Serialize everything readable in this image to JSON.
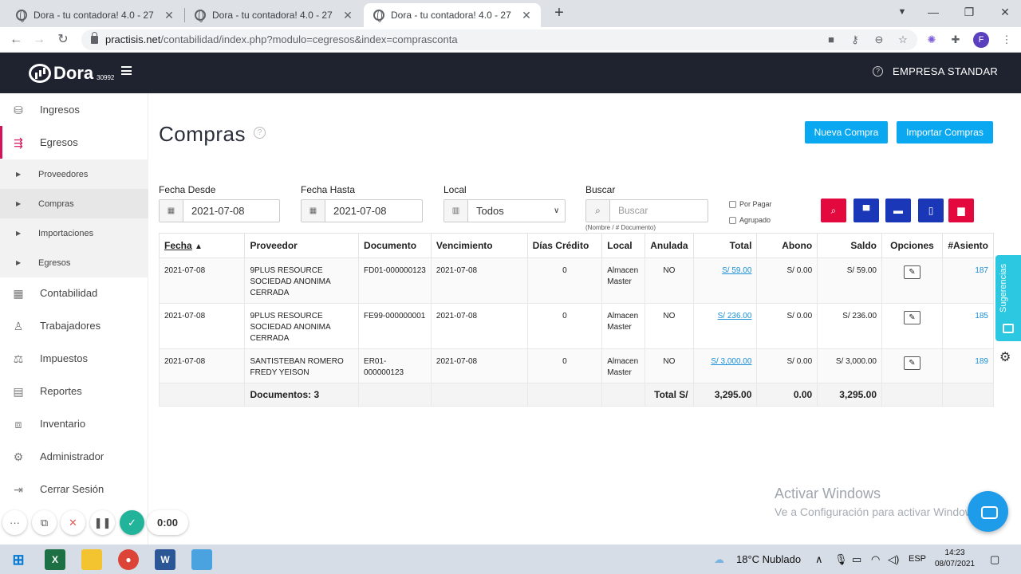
{
  "browser": {
    "tabs": [
      {
        "title": "Dora - tu contadora! 4.0 - 27",
        "active": false
      },
      {
        "title": "Dora - tu contadora! 4.0 - 27",
        "active": false
      },
      {
        "title": "Dora - tu contadora! 4.0 - 27",
        "active": true
      }
    ],
    "url_host": "practisis.net",
    "url_path": "/contabilidad/index.php?modulo=cegresos&index=comprasconta",
    "profile_initial": "F"
  },
  "header": {
    "brand": "Dora",
    "brand_code": "30992",
    "company": "EMPRESA STANDAR"
  },
  "sidebar": {
    "items": [
      {
        "label": "Ingresos",
        "icon": "coins-icon"
      },
      {
        "label": "Egresos",
        "icon": "cash-out-icon",
        "active": true
      },
      {
        "label": "Contabilidad",
        "icon": "calculator-icon"
      },
      {
        "label": "Trabajadores",
        "icon": "workers-icon"
      },
      {
        "label": "Impuestos",
        "icon": "taxes-icon"
      },
      {
        "label": "Reportes",
        "icon": "report-icon"
      },
      {
        "label": "Inventario",
        "icon": "boxes-icon"
      },
      {
        "label": "Administrador",
        "icon": "gear-icon"
      },
      {
        "label": "Cerrar Sesión",
        "icon": "logout-icon"
      }
    ],
    "subitems": [
      {
        "label": "Proveedores"
      },
      {
        "label": "Compras",
        "current": true
      },
      {
        "label": "Importaciones"
      },
      {
        "label": "Egresos"
      }
    ]
  },
  "page": {
    "title": "Compras",
    "new_button": "Nueva Compra",
    "import_button": "Importar Compras"
  },
  "filters": {
    "fecha_desde_label": "Fecha Desde",
    "fecha_desde_value": "2021-07-08",
    "fecha_hasta_label": "Fecha Hasta",
    "fecha_hasta_value": "2021-07-08",
    "local_label": "Local",
    "local_value": "Todos",
    "buscar_label": "Buscar",
    "buscar_placeholder": "Buscar",
    "buscar_hint": "(Nombre / # Documento)",
    "por_pagar_label": "Por Pagar",
    "agrupado_label": "Agrupado"
  },
  "colors": {
    "primary": "#0aa8f0",
    "danger": "#e3093f",
    "navy": "#1a37b8",
    "accent": "#d4145a",
    "header_bg": "#1f2330"
  },
  "table": {
    "headers": [
      "Fecha",
      "Proveedor",
      "Documento",
      "Vencimiento",
      "Días Crédito",
      "Local",
      "Anulada",
      "Total",
      "Abono",
      "Saldo",
      "Opciones",
      "#Asiento"
    ],
    "rows": [
      {
        "fecha": "2021-07-08",
        "proveedor": "9PLUS RESOURCE SOCIEDAD ANONIMA CERRADA",
        "documento": "FD01-000000123",
        "vencimiento": "2021-07-08",
        "dias": "0",
        "local": "Almacen Master",
        "anulada": "NO",
        "total": "S/ 59.00",
        "abono": "S/ 0.00",
        "saldo": "S/ 59.00",
        "asiento": "187"
      },
      {
        "fecha": "2021-07-08",
        "proveedor": "9PLUS RESOURCE SOCIEDAD ANONIMA CERRADA",
        "documento": "FE99-000000001",
        "vencimiento": "2021-07-08",
        "dias": "0",
        "local": "Almacen Master",
        "anulada": "NO",
        "total": "S/ 236.00",
        "abono": "S/ 0.00",
        "saldo": "S/ 236.00",
        "asiento": "185"
      },
      {
        "fecha": "2021-07-08",
        "proveedor": "SANTISTEBAN ROMERO FREDY YEISON",
        "documento": "ER01-000000123",
        "vencimiento": "2021-07-08",
        "dias": "0",
        "local": "Almacen Master",
        "anulada": "NO",
        "total": "S/ 3,000.00",
        "abono": "S/ 0.00",
        "saldo": "S/ 3,000.00",
        "asiento": "189"
      }
    ],
    "footer": {
      "documentos": "Documentos: 3",
      "total_label": "Total S/",
      "total": "3,295.00",
      "abono": "0.00",
      "saldo": "3,295.00"
    }
  },
  "widgets": {
    "sugerencias": "Sugerencias"
  },
  "watermark": {
    "line1": "Activar Windows",
    "line2": "Ve a Configuración para activar Windows."
  },
  "recorder": {
    "time": "0:00"
  },
  "taskbar": {
    "weather": "18°C  Nublado",
    "lang": "ESP",
    "time": "14:23",
    "date": "08/07/2021"
  }
}
